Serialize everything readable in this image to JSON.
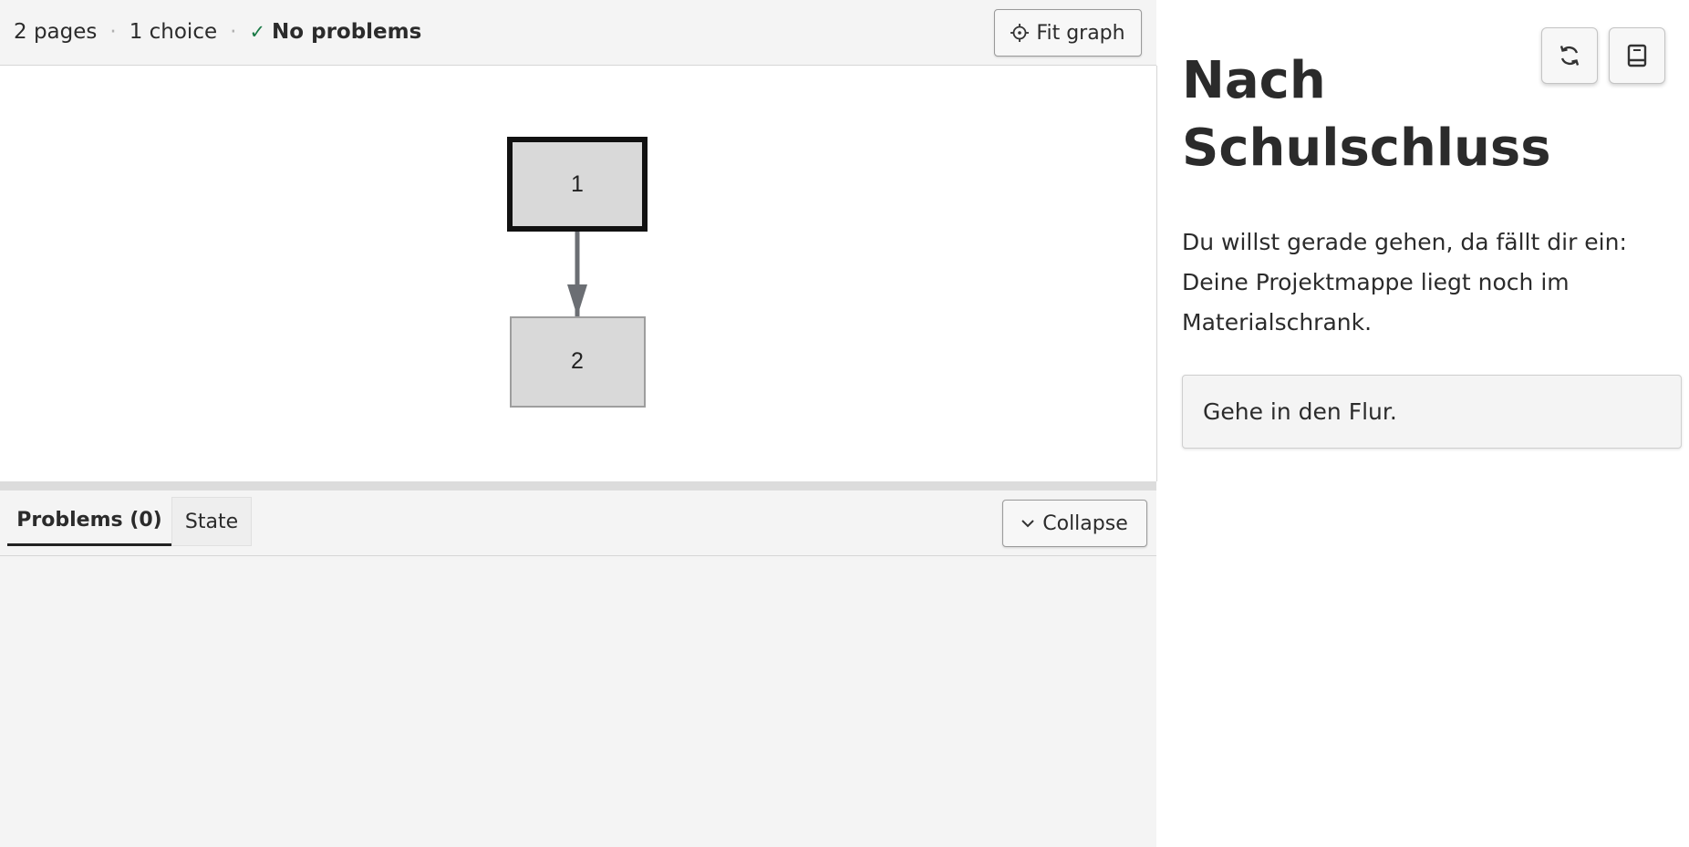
{
  "stats": {
    "pages": "2 pages",
    "separator": "·",
    "choices": "1 choice",
    "problems": "No problems"
  },
  "toolbar": {
    "fit_graph_label": "Fit graph"
  },
  "graph": {
    "nodes": [
      {
        "label": "1",
        "selected": true
      },
      {
        "label": "2",
        "selected": false
      }
    ],
    "edges": [
      {
        "from": "1",
        "to": "2"
      }
    ]
  },
  "bottom_panel": {
    "tabs": [
      {
        "label": "Problems (0)",
        "active": true
      },
      {
        "label": "State",
        "active": false
      }
    ],
    "collapse_label": "Collapse"
  },
  "preview": {
    "title_line1": "Nach",
    "title_line2": "Schulschluss",
    "body": "Du willst gerade gehen, da fällt dir ein: Deine Projektmappe liegt noch im Materialschrank.",
    "choices": [
      "Gehe in den Flur."
    ],
    "icons": [
      "refresh-icon",
      "book-icon"
    ]
  },
  "colors": {
    "success": "#1a7a46",
    "node_fill": "#d9d9d9",
    "edge": "#6b6e73"
  }
}
